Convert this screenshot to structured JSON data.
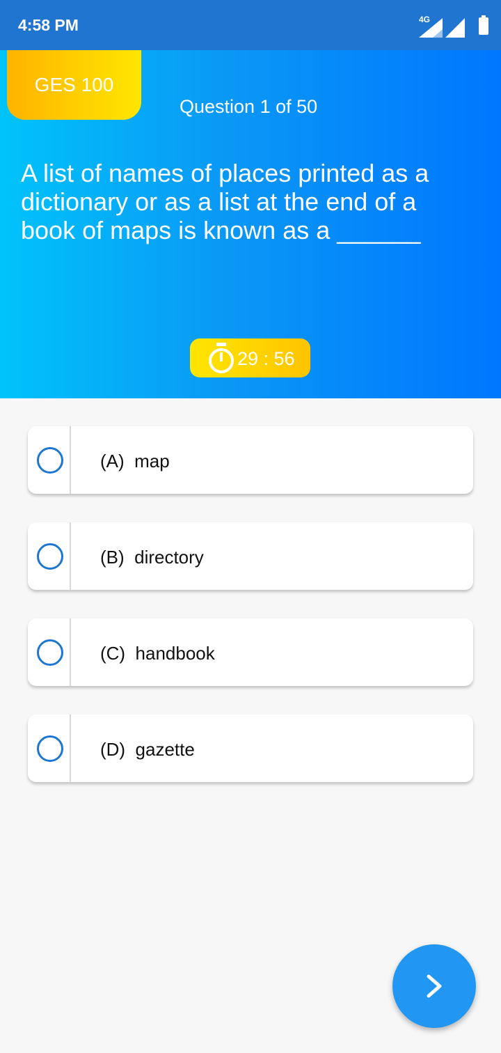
{
  "status_bar": {
    "time": "4:58 PM",
    "network": "4G",
    "icons": [
      "signal-icon",
      "signal-icon",
      "battery-icon"
    ]
  },
  "quiz": {
    "course": "GES 100",
    "question_counter": "Question 1 of 50",
    "question": "A list of names of places printed as a dictionary or as a list at the end of a book of maps is known as a ______",
    "timer": "29 : 56",
    "options": [
      {
        "label": "(A)  map"
      },
      {
        "label": "(B)  directory"
      },
      {
        "label": "(C)  handbook"
      },
      {
        "label": "(D)  gazette"
      }
    ],
    "next_icon": "chevron-right-icon"
  },
  "colors": {
    "status_bar": "#1f75cf",
    "header_gradient_start": "#00c3fa",
    "header_gradient_end": "#0077ff",
    "badge_yellow": "#ffd000",
    "radio_blue": "#1c76d2",
    "fab_blue": "#2196f3"
  }
}
